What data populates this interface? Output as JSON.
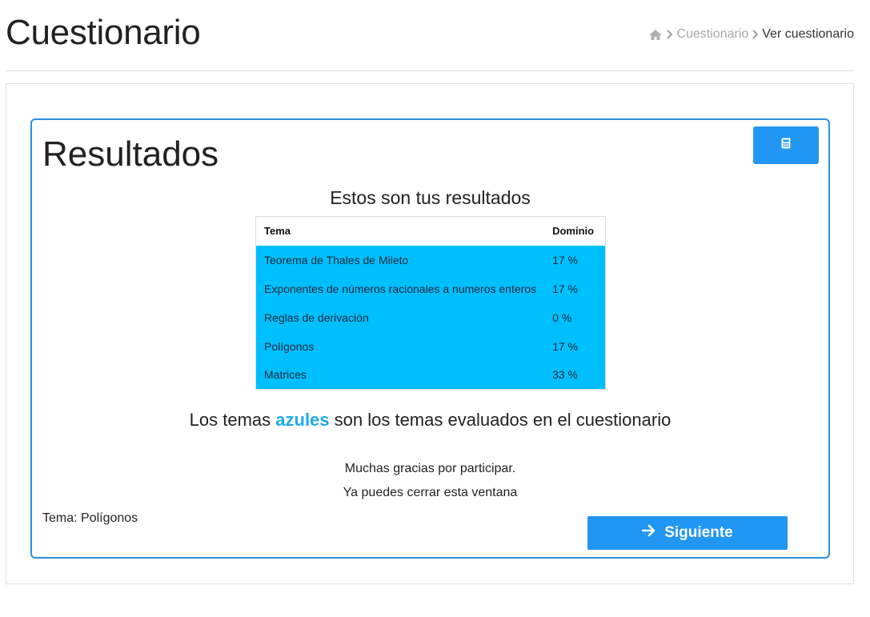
{
  "header": {
    "title": "Cuestionario",
    "breadcrumb": {
      "home_icon": "home-icon",
      "separator_icon": "chevron-right-icon",
      "link": "Cuestionario",
      "current": "Ver cuestionario"
    }
  },
  "results": {
    "heading": "Resultados",
    "calculator_icon": "calculator-icon",
    "subtitle": "Estos son tus resultados",
    "table": {
      "headers": [
        "Tema",
        "Dominio"
      ],
      "rows": [
        [
          "Teorema de Thales de Mileto",
          "17 %"
        ],
        [
          "Exponentes de números racionales a numeros enteros",
          "17 %"
        ],
        [
          "Reglas de derivación",
          "0 %"
        ],
        [
          "Polígonos",
          "17 %"
        ],
        [
          "Matrices",
          "33 %"
        ]
      ]
    },
    "legend": {
      "before": "Los temas ",
      "highlight": "azules",
      "after": " son los temas evaluados en el cuestionario"
    },
    "thanks": "Muchas gracias por participar.",
    "close_note": "Ya puedes cerrar esta ventana",
    "tema_footer": "Tema: Polígonos",
    "next_button": {
      "label": "Siguiente",
      "icon": "arrow-right-icon"
    }
  },
  "colors": {
    "accent": "#2196f3",
    "card_border": "#2a8fe0",
    "evaluated_row": "#00bfff",
    "highlight_text": "#1fa8e8"
  }
}
